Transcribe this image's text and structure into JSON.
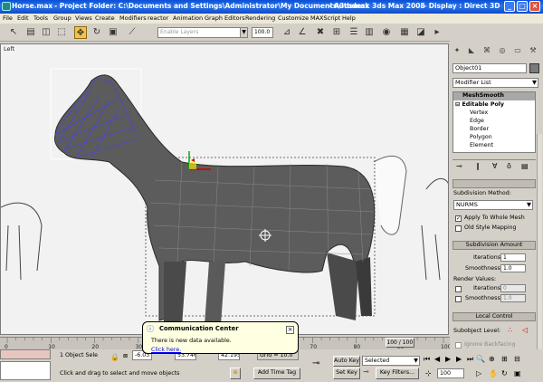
{
  "window": {
    "file": "Horse.max",
    "project": "- Project Folder: C:\\Documents and Settings\\Administrator\\My Documents\\3dsmax",
    "app": "- Autodesk 3ds Max 2008",
    "display": "- Display : Direct 3D"
  },
  "menu": [
    "File",
    "Edit",
    "Tools",
    "Group",
    "Views",
    "Create",
    "Modifiers",
    "reactor",
    "Animation",
    "Graph Editors",
    "Rendering",
    "Customize",
    "MAXScript",
    "Help"
  ],
  "toolbar": {
    "selection_set_placeholder": "Enable Layers",
    "percent": "100.0"
  },
  "viewport": {
    "label": "Left"
  },
  "panel": {
    "object_name": "Object01",
    "modifier_list": "Modifier List",
    "stack": [
      "MeshSmooth",
      "Editable Poly",
      "Vertex",
      "Edge",
      "Border",
      "Polygon",
      "Element"
    ],
    "subdivision_method_label": "Subdivision Method:",
    "subdivision_method": "NURMS",
    "apply_whole_mesh": "Apply To Whole Mesh",
    "old_style": "Old Style Mapping",
    "subdivision_amount": "Subdivision Amount",
    "iterations_label": "Iterations:",
    "iterations": "1",
    "smoothness_label": "Smoothness:",
    "smoothness": "1.0",
    "render_values": "Render Values:",
    "r_iterations": "0",
    "r_smoothness": "1.0",
    "local_control": "Local Control",
    "subobject_level": "Subobject Level:",
    "ignore_backfacing": "Ignore Backfacing"
  },
  "timeline": {
    "position": "100 / 100",
    "ticks": [
      "0",
      "10",
      "20",
      "30",
      "40",
      "50",
      "60",
      "70",
      "80",
      "90",
      "100"
    ],
    "scroll_fraction": 0.9
  },
  "status": {
    "selected": "1 Object Sele",
    "x": "-6.03",
    "y": "53.746",
    "z": "42.195",
    "grid": "Grid = 10.0",
    "prompt": "Click and drag to select and move objects",
    "add_time_tag": "Add Time Tag",
    "auto_key": "Auto Key",
    "set_key": "Set Key",
    "selected_dropdown": "Selected",
    "key_filters": "Key Filters...",
    "frame": "100"
  },
  "balloon": {
    "title": "Communication Center",
    "message": "There is new data available.",
    "link": "Click here."
  }
}
